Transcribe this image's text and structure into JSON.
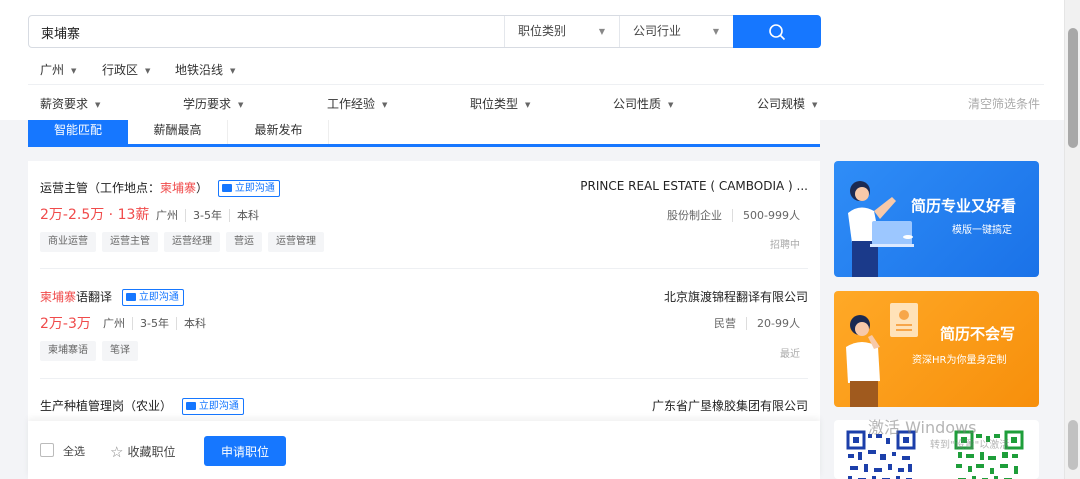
{
  "search": {
    "value": "柬埔寨",
    "job_category": "职位类别",
    "industry": "公司行业"
  },
  "filters": {
    "city": "广州",
    "district": "行政区",
    "metro": "地铁沿线",
    "salary": "薪资要求",
    "education": "学历要求",
    "experience": "工作经验",
    "job_type": "职位类型",
    "company_nature": "公司性质",
    "company_size": "公司规模",
    "clear": "清空筛选条件"
  },
  "tabs": [
    "智能匹配",
    "薪酬最高",
    "最新发布"
  ],
  "chat_label": "立即沟通",
  "jobs": [
    {
      "title_pre": "运营主管（工作地点：",
      "title_hl": "柬埔寨",
      "title_post": "）",
      "salary": "2万-2.5万 · 13薪",
      "city": "广州",
      "experience": "3-5年",
      "education": "本科",
      "tags": [
        "商业运营",
        "运营主管",
        "运营经理",
        "营运",
        "运营管理"
      ],
      "company": "PRINCE REAL ESTATE ( CAMBODIA ) ...",
      "company_type": "股份制企业",
      "company_size": "500-999人",
      "status": "招聘中"
    },
    {
      "title_pre": "",
      "title_hl": "柬埔寨",
      "title_post": "语翻译",
      "salary": "2万-3万",
      "city": "广州",
      "experience": "3-5年",
      "education": "本科",
      "tags": [
        "柬埔寨语",
        "笔译"
      ],
      "company": "北京旗渡锦程翻译有限公司",
      "company_type": "民营",
      "company_size": "20-99人",
      "status": "最近"
    },
    {
      "title_pre": "生产种植管理岗（农业）",
      "title_hl": "",
      "title_post": "",
      "company": "广东省广垦橡胶集团有限公司"
    }
  ],
  "actions": {
    "select_all": "全选",
    "favorite": "收藏职位",
    "apply": "申请职位"
  },
  "ads": [
    {
      "title": "简历专业又好看",
      "subtitle": "模版一键搞定"
    },
    {
      "title": "简历不会写",
      "subtitle": "资深HR为你量身定制"
    }
  ],
  "watermark": {
    "line1": "激活 Windows",
    "line2": "转到\"设置\"以激活"
  },
  "colors": {
    "accent": "#1677ff",
    "salary": "#f04b4b",
    "ad_blue": "#2f8df7",
    "ad_orange": "#ffa927"
  }
}
